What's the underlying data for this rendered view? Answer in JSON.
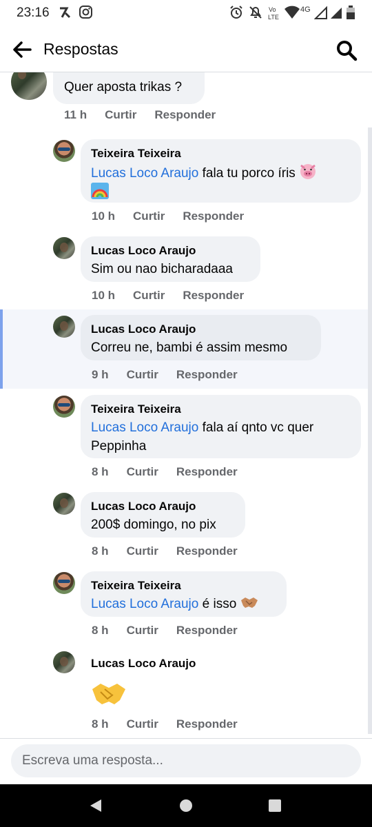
{
  "status_bar": {
    "time": "23:16",
    "network": "4G"
  },
  "header": {
    "title": "Respostas"
  },
  "parent": {
    "text": "Quer aposta trikas ?",
    "time": "11 h",
    "like": "Curtir",
    "reply": "Responder"
  },
  "replies": [
    {
      "name": "Teixeira Teixeira",
      "mention": "Lucas Loco Araujo",
      "text": " fala tu porco íris",
      "time": "10 h",
      "like": "Curtir",
      "reply": "Responder"
    },
    {
      "name": "Lucas Loco Araujo",
      "text": "Sim ou nao bicharadaaa",
      "time": "10 h",
      "like": "Curtir",
      "reply": "Responder"
    },
    {
      "name": "Lucas Loco Araujo",
      "text": "Correu ne, bambi é assim mesmo",
      "time": "9 h",
      "like": "Curtir",
      "reply": "Responder"
    },
    {
      "name": "Teixeira Teixeira",
      "mention": "Lucas Loco Araujo",
      "text": " fala aí qnto vc quer",
      "text2": "Peppinha",
      "time": "8 h",
      "like": "Curtir",
      "reply": "Responder"
    },
    {
      "name": "Lucas Loco Araujo",
      "text": "200$ domingo, no pix",
      "time": "8 h",
      "like": "Curtir",
      "reply": "Responder"
    },
    {
      "name": "Teixeira Teixeira",
      "mention": "Lucas Loco Araujo",
      "text": " é isso",
      "time": "8 h",
      "like": "Curtir",
      "reply": "Responder"
    },
    {
      "name": "Lucas Loco Araujo",
      "time": "8 h",
      "like": "Curtir",
      "reply": "Responder"
    }
  ],
  "composer": {
    "placeholder": "Escreva uma resposta..."
  },
  "colors": {
    "mention": "#216fdb",
    "bubble": "#f0f2f5",
    "meta": "#65676b",
    "highlight_bar": "#7da2ec"
  }
}
